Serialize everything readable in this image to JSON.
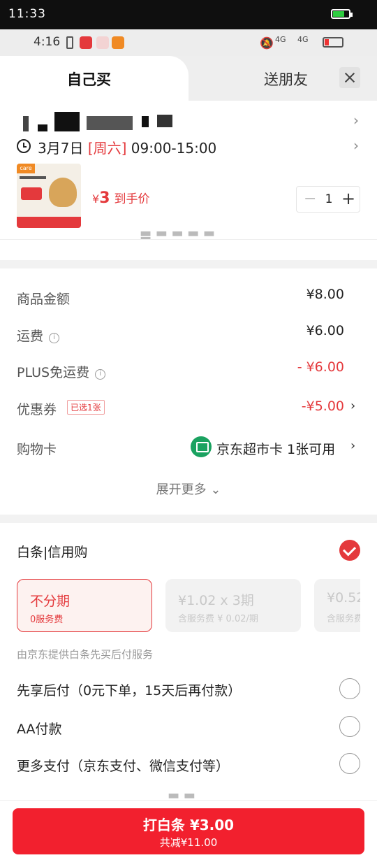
{
  "system": {
    "time": "11:33"
  },
  "phone_status": {
    "time": "4:16",
    "signal_1": "4G",
    "signal_2": "4G"
  },
  "tabs": {
    "self": "自己买",
    "friend": "送朋友"
  },
  "delivery": {
    "date": "3月7日",
    "weekday": "[周六]",
    "window": "09:00-15:00"
  },
  "product": {
    "brand_tag": "care",
    "price_symbol": "¥",
    "price": "3",
    "price_suffix": "到手价",
    "quantity": "1"
  },
  "cost_rows": [
    {
      "label": "商品金额",
      "value": "¥8.00"
    },
    {
      "label": "运费",
      "value": "¥6.00"
    },
    {
      "label": "PLUS免运费",
      "value": "- ¥6.00"
    },
    {
      "label": "优惠券",
      "badge": "已选1张",
      "value": "-¥5.00"
    },
    {
      "label": "购物卡",
      "value": "京东超市卡  1张可用"
    }
  ],
  "expand_more": "展开更多",
  "baitiao": {
    "title": "白条|信用购",
    "plans": [
      {
        "title": "不分期",
        "sub": "0服务费"
      },
      {
        "title": "¥1.02 x 3期",
        "sub": "含服务费 ¥ 0.02/期"
      },
      {
        "title": "¥0.52",
        "sub": "含服务费"
      }
    ],
    "provider": "由京东提供白条先买后付服务"
  },
  "payment_options": [
    "先享后付（0元下单，15天后再付款）",
    "AA付款",
    "更多支付（京东支付、微信支付等）"
  ],
  "bottom": {
    "button_label": "打白条 ¥3.00",
    "saving": "共减¥11.00"
  },
  "colors": {
    "accent": "#e4393c",
    "button": "#f2202e",
    "card_icon": "#1aa260"
  }
}
